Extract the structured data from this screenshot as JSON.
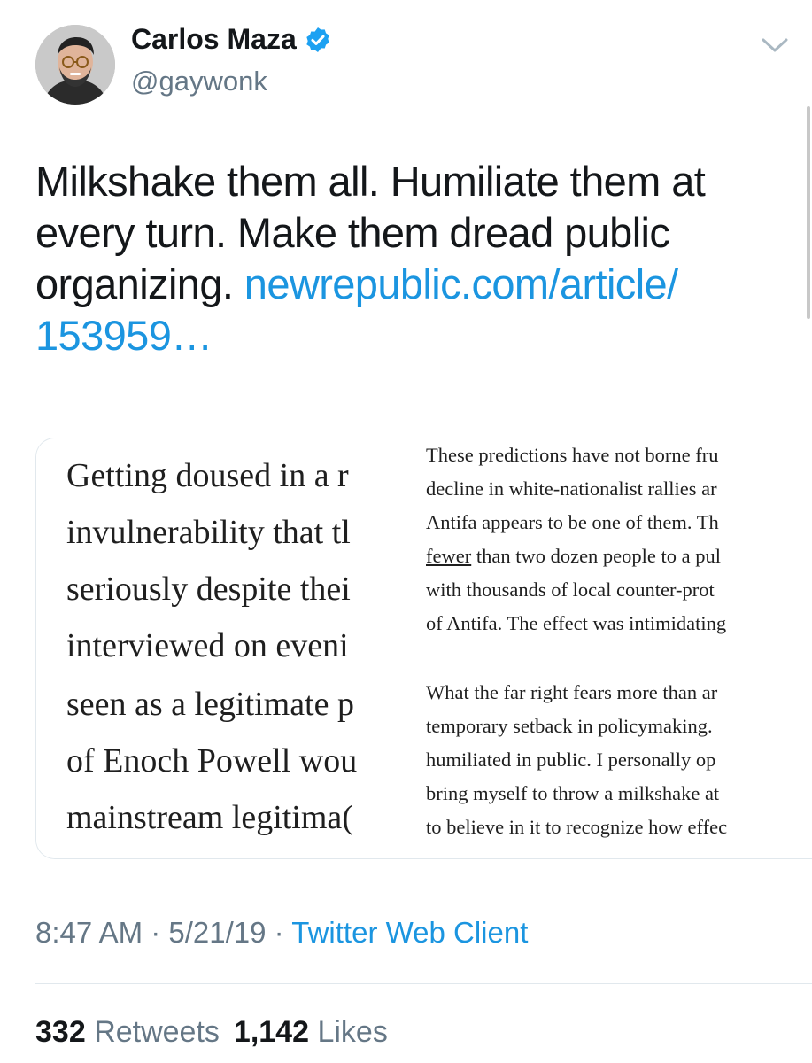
{
  "author": {
    "name": "Carlos Maza",
    "handle": "@gaywonk",
    "verified_icon": "verified-badge-icon",
    "avatar_icon": "avatar-icon"
  },
  "menu": {
    "icon": "chevron-down-icon"
  },
  "tweet": {
    "text_parts": [
      "Milkshake them all. Humiliate them at every turn. Make them dread public organizing. "
    ],
    "link_text": "newrepublic.com/article/ 153959…"
  },
  "media": {
    "left_lines": [
      "Getting doused in a r",
      "invulnerability that tl",
      "seriously despite thei",
      "interviewed on eveni",
      "seen as a legitimate p",
      "of Enoch Powell wou",
      "mainstream legitima("
    ],
    "right_lines": [
      {
        "text": "These predictions have not borne fru",
        "pre": "",
        "underline": ""
      },
      {
        "text": "decline in white-nationalist rallies ar",
        "pre": "",
        "underline": ""
      },
      {
        "text": "Antifa appears to be one of them. Th",
        "pre": "",
        "underline": ""
      },
      {
        "text": " than two dozen people to a pul",
        "pre": "",
        "underline": "fewer"
      },
      {
        "text": "with thousands of local counter-prot",
        "pre": "",
        "underline": ""
      },
      {
        "text": "of Antifa. The effect was intimidating",
        "pre": "",
        "underline": ""
      },
      {
        "text": "What the far right fears more than ar",
        "pre": "",
        "underline": ""
      },
      {
        "text": "temporary setback in policymaking. ",
        "pre": "",
        "underline": ""
      },
      {
        "text": "humiliated in public. I personally op",
        "pre": "",
        "underline": ""
      },
      {
        "text": "bring myself to throw a milkshake at",
        "pre": "",
        "underline": ""
      },
      {
        "text": "to believe in it to recognize how effec",
        "pre": "",
        "underline": ""
      }
    ]
  },
  "meta": {
    "time": "8:47 AM",
    "sep1": " · ",
    "date": "5/21/19",
    "sep2": " · ",
    "source": "Twitter Web Client"
  },
  "stats": {
    "retweets_count": "332",
    "retweets_label": "Retweets",
    "likes_count": "1,142",
    "likes_label": "Likes"
  },
  "colors": {
    "link": "#1b95e0",
    "secondary_text": "#657786",
    "primary_text": "#14171a"
  }
}
